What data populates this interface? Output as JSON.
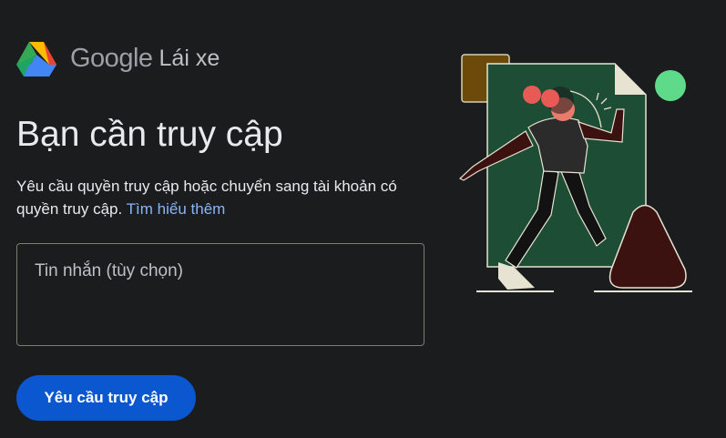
{
  "brand": {
    "logo_icon": "google-drive-icon",
    "google_text": "Google",
    "product_text": "Lái xe"
  },
  "main": {
    "title": "Bạn cần truy cập",
    "description": "Yêu cầu quyền truy cập hoặc chuyển sang tài khoản có quyền truy cập.",
    "learn_more_link": "Tìm hiểu thêm"
  },
  "message_field": {
    "placeholder": "Tin nhắn (tùy chọn)",
    "value": ""
  },
  "request_button": {
    "label": "Yêu cầu truy cập"
  },
  "colors": {
    "background": "#1b1c1e",
    "primary_button": "#0b57d0",
    "link": "#8ab4f8",
    "illustration_green": "#1e4d35",
    "illustration_maroon": "#3c1210",
    "illustration_gold": "#6b4a0a",
    "illustration_mint": "#5fd98a"
  }
}
